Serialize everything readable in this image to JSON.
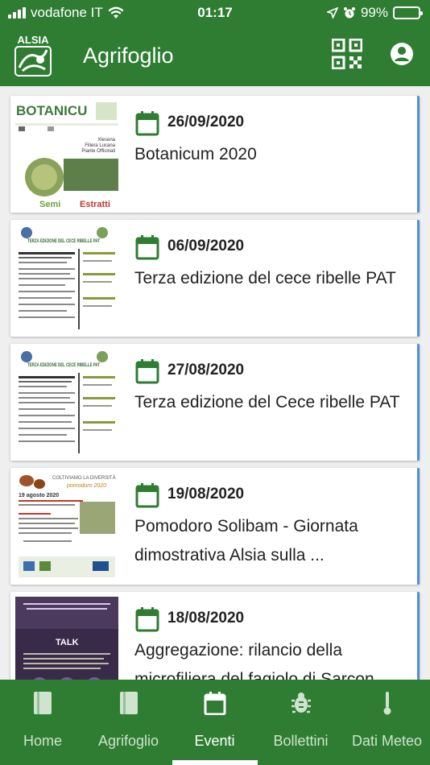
{
  "status": {
    "carrier": "vodafone IT",
    "time": "01:17",
    "battery": "99%"
  },
  "appbar": {
    "title": "Agrifoglio",
    "logo_text": "ALSIA"
  },
  "events": [
    {
      "date": "26/09/2020",
      "title": "Botanicum 2020",
      "thumb": {
        "heading": "BOTANICU",
        "sub1": "Xlesena",
        "sub2": "Filiera Lucana",
        "sub3": "Piante Officinali",
        "foot_a": "Semi",
        "foot_b": "Estratti"
      }
    },
    {
      "date": "06/09/2020",
      "title": "Terza edizione del cece ribelle PAT",
      "thumb": {
        "heading": "TERZA EDIZIONE DEL CECE RIBELLE PAT"
      }
    },
    {
      "date": "27/08/2020",
      "title": "Terza edizione del Cece ribelle PAT",
      "thumb": {
        "heading": "TERZA EDIZIONE DEL CECE RIBELLE PAT"
      }
    },
    {
      "date": "19/08/2020",
      "title": "Pomodoro Solibam - Giornata dimostrativa Alsia sulla ...",
      "thumb": {
        "heading": "COLTIVIAMO LA DIVERSITÀ",
        "sub1": "pomodoro 2020",
        "sub2": "19 agosto 2020"
      }
    },
    {
      "date": "18/08/2020",
      "title": "Aggregazione: rilancio della microfiliera del fagiolo di Sarcon",
      "thumb": {
        "heading": "TALK"
      }
    }
  ],
  "nav": [
    {
      "label": "Home",
      "icon": "book-icon",
      "active": false
    },
    {
      "label": "Agrifoglio",
      "icon": "book-icon",
      "active": false
    },
    {
      "label": "Eventi",
      "icon": "calendar-icon",
      "active": true
    },
    {
      "label": "Bollettini",
      "icon": "bug-icon",
      "active": false
    },
    {
      "label": "Dati Meteo",
      "icon": "thermometer-icon",
      "active": false
    }
  ],
  "colors": {
    "primary": "#2e7d32",
    "accent": "#4a90e2"
  }
}
